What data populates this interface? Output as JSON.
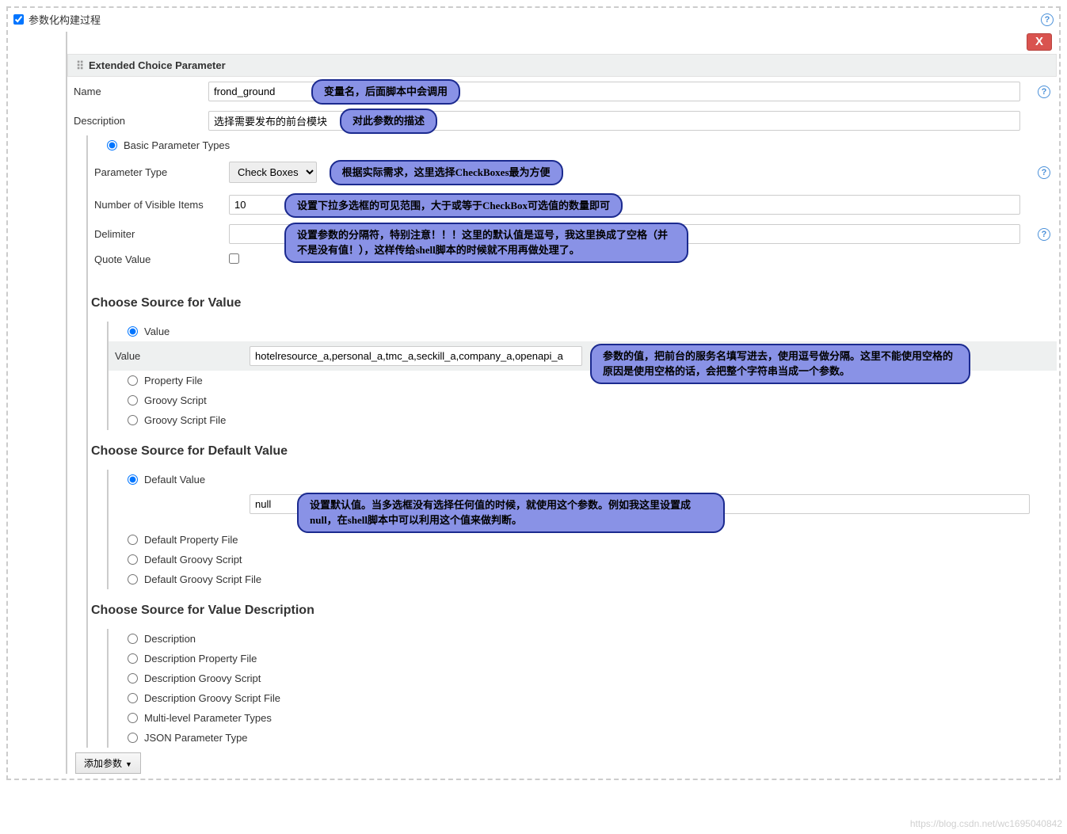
{
  "header": {
    "checkbox_label": "参数化构建过程"
  },
  "section": {
    "title": "Extended Choice Parameter"
  },
  "fields": {
    "name_label": "Name",
    "name_value": "frond_ground",
    "name_annot": "变量名，后面脚本中会调用",
    "desc_label": "Description",
    "desc_value": "选择需要发布的前台模块",
    "desc_annot": "对此参数的描述",
    "basic_param_types": "Basic Parameter Types",
    "param_type_label": "Parameter Type",
    "param_type_value": "Check Boxes",
    "param_type_annot": "根据实际需求，这里选择CheckBoxes最为方便",
    "visible_items_label": "Number of Visible Items",
    "visible_items_value": "10",
    "visible_items_annot": "设置下拉多选框的可见范围，大于或等于CheckBox可选值的数量即可",
    "delimiter_label": "Delimiter",
    "delimiter_value": "",
    "delimiter_annot": "设置参数的分隔符，特别注意！！！这里的默认值是逗号，我这里换成了空格（并不是没有值！），这样传给shell脚本的时候就不用再做处理了。",
    "quote_label": "Quote Value"
  },
  "source_value": {
    "title": "Choose Source for Value",
    "value_radio": "Value",
    "value_label": "Value",
    "value_input": "hotelresource_a,personal_a,tmc_a,seckill_a,company_a,openapi_a",
    "value_annot": "参数的值，把前台的服务名填写进去，使用逗号做分隔。这里不能使用空格的原因是使用空格的话，会把整个字符串当成一个参数。",
    "property_file": "Property File",
    "groovy_script": "Groovy Script",
    "groovy_script_file": "Groovy Script File"
  },
  "source_default": {
    "title": "Choose Source for Default Value",
    "default_value_radio": "Default Value",
    "default_value_input": "null",
    "default_value_annot": "设置默认值。当多选框没有选择任何值的时候，就使用这个参数。例如我这里设置成null，在shell脚本中可以利用这个值来做判断。",
    "default_property_file": "Default Property File",
    "default_groovy_script": "Default Groovy Script",
    "default_groovy_script_file": "Default Groovy Script File"
  },
  "source_desc": {
    "title": "Choose Source for Value Description",
    "description": "Description",
    "desc_property_file": "Description Property File",
    "desc_groovy_script": "Description Groovy Script",
    "desc_groovy_script_file": "Description Groovy Script File",
    "multi_level": "Multi-level Parameter Types",
    "json_param": "JSON Parameter Type"
  },
  "footer": {
    "add_param": "添加参数"
  },
  "watermark": "https://blog.csdn.net/wc1695040842"
}
